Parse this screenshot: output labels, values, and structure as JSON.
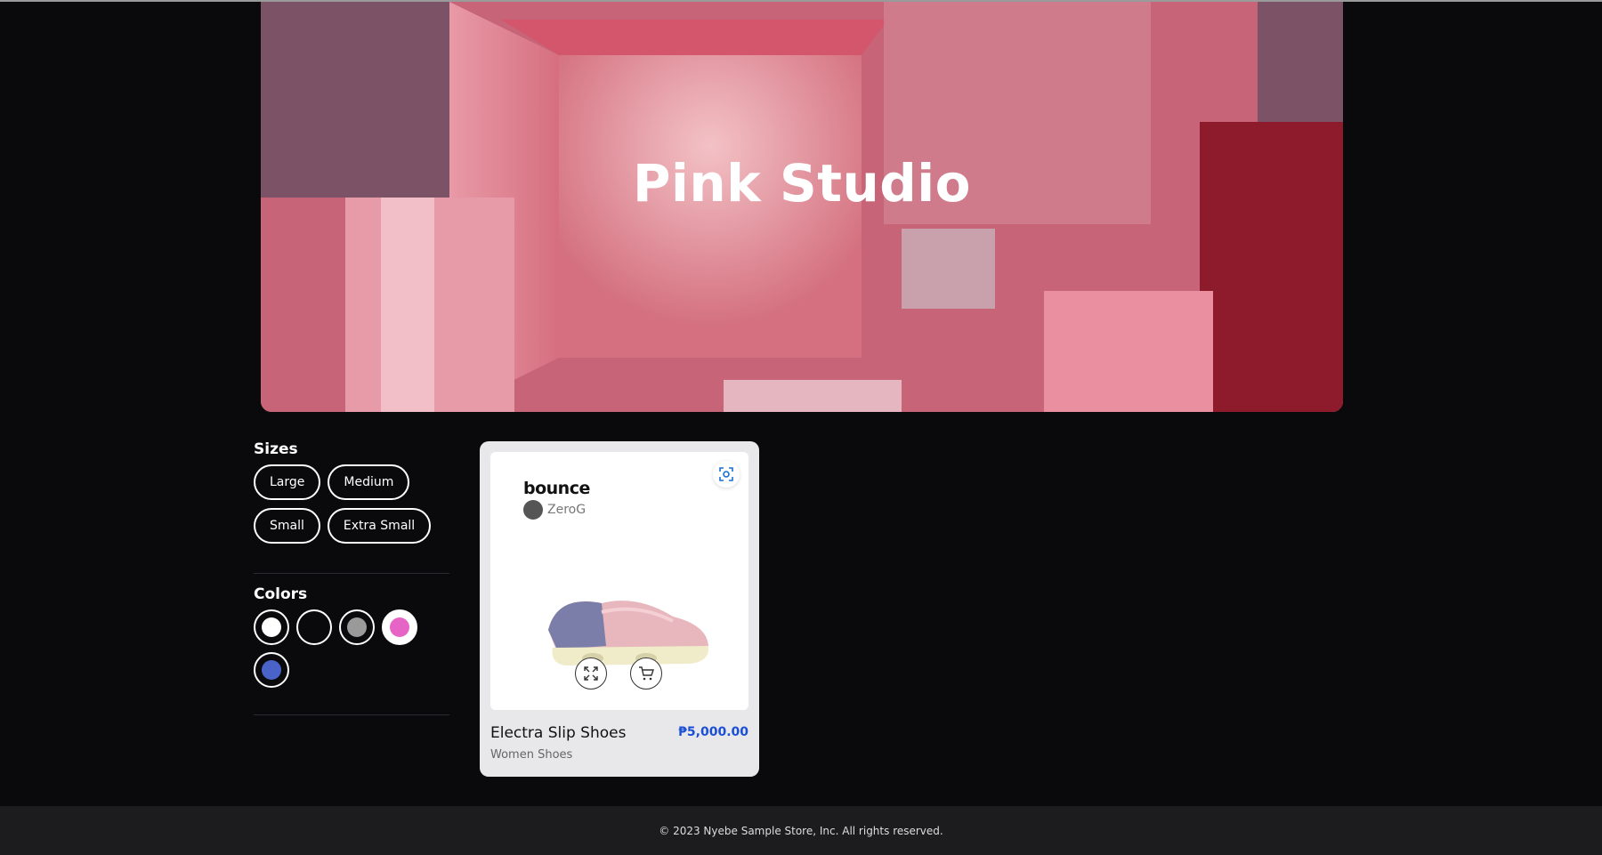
{
  "hero": {
    "title": "Pink Studio"
  },
  "filters": {
    "sizes_title": "Sizes",
    "sizes": [
      "Large",
      "Medium",
      "Small",
      "Extra Small"
    ],
    "colors_title": "Colors",
    "colors": [
      "#ffffff",
      "#0a0a0c",
      "#9a9a9a",
      "#e664c6",
      "#4a63c9"
    ]
  },
  "product": {
    "brand": "bounce",
    "brand_sub": "ZeroG",
    "name": "Electra Slip Shoes",
    "price": "₱5,000.00",
    "category": "Women Shoes",
    "icons": [
      "scan-icon",
      "expand-icon",
      "cart-icon"
    ]
  },
  "footer": {
    "copyright": "© 2023 Nyebe Sample Store, Inc. All rights reserved."
  }
}
